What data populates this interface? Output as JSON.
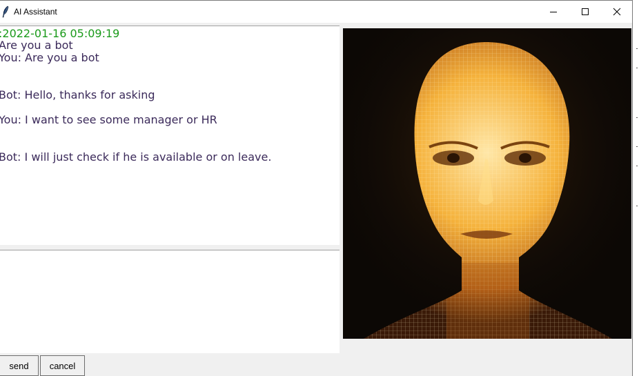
{
  "window": {
    "title": "AI Assistant"
  },
  "chat": {
    "lines": [
      {
        "text": ":2022-01-16 05:09:19",
        "kind": "timestamp"
      },
      {
        "text": "Are you a bot",
        "kind": "message"
      },
      {
        "text": "You: Are you a bot",
        "kind": "message"
      },
      {
        "text": "Bot: Hello, thanks for asking",
        "kind": "message"
      },
      {
        "text": "You: I want to see some manager or HR",
        "kind": "message"
      },
      {
        "text": "Bot: I will just check if he is available or on leave.",
        "kind": "message"
      }
    ]
  },
  "input": {
    "value": ""
  },
  "buttons": {
    "send_label": "send",
    "cancel_label": "cancel"
  },
  "colors": {
    "timestamp": "#1a9a1a",
    "message": "#3b2a5a",
    "avatar_glow": "#f5b23c"
  },
  "icons": {
    "app": "feather-icon",
    "minimize": "minimize-icon",
    "maximize": "maximize-icon",
    "close": "close-icon"
  }
}
